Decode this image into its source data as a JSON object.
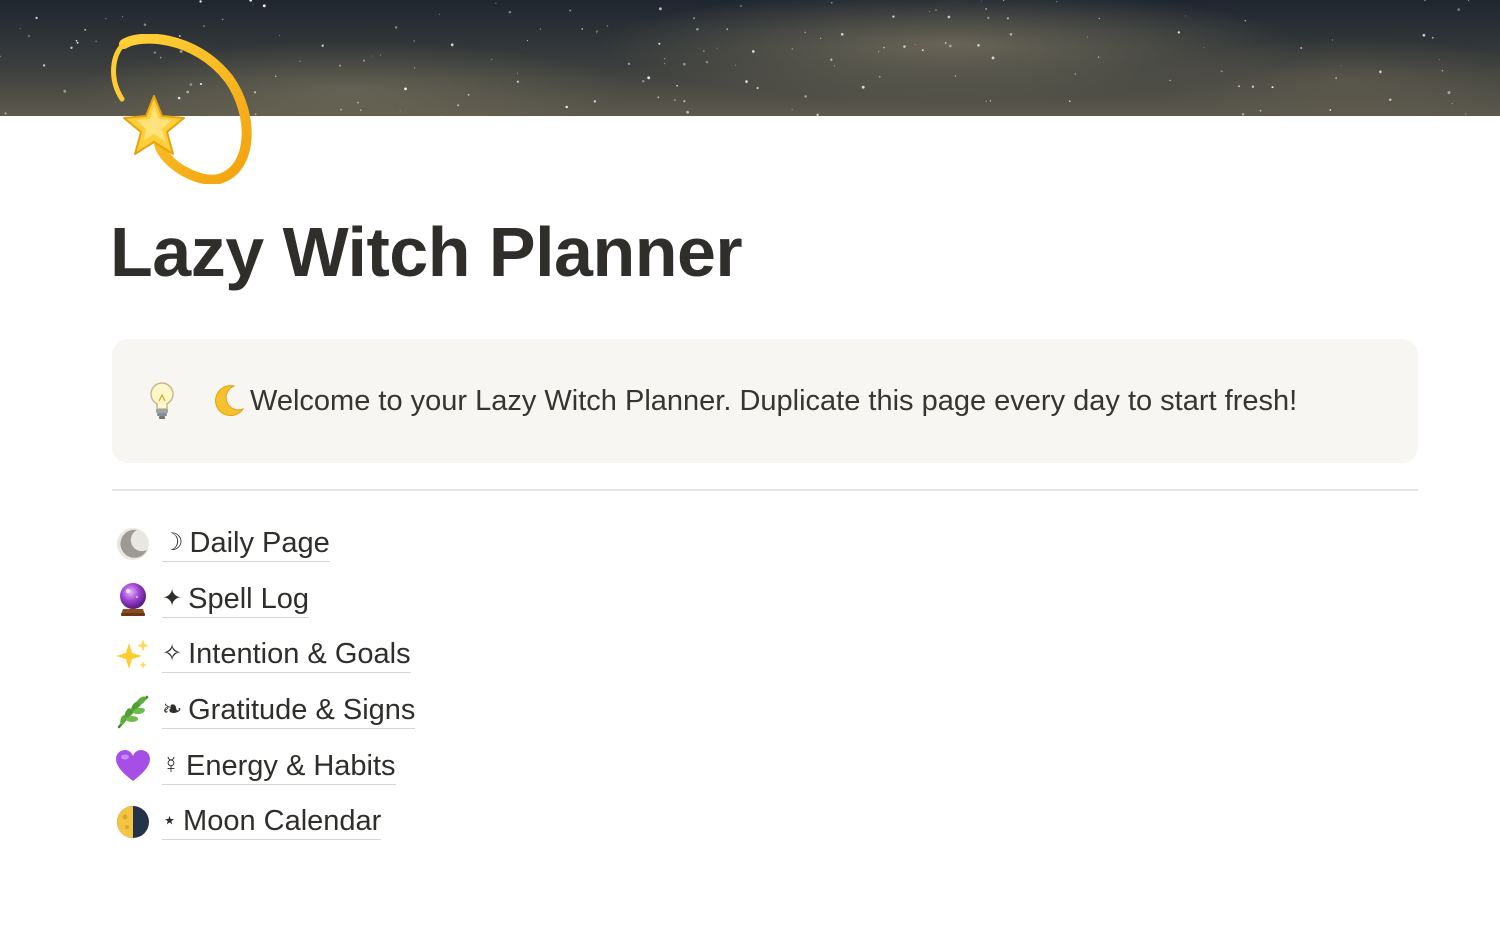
{
  "page": {
    "title": "Lazy Witch Planner",
    "icon": "dizzy-star-icon",
    "cover": "starry-night-sky"
  },
  "callout": {
    "icon": "lightbulb-icon",
    "moon_icon": "crescent-moon-icon",
    "text": "Welcome to your Lazy Witch Planner. Duplicate this page every day to start fresh!"
  },
  "links": [
    {
      "emoji": "crescent-moon-gray-icon",
      "glyph": "☽",
      "label": "Daily Page"
    },
    {
      "emoji": "crystal-ball-icon",
      "glyph": "✦",
      "label": "Spell Log"
    },
    {
      "emoji": "sparkles-icon",
      "glyph": "✧",
      "label": "Intention & Goals"
    },
    {
      "emoji": "herb-icon",
      "glyph": "❧",
      "label": "Gratitude & Signs"
    },
    {
      "emoji": "purple-heart-icon",
      "glyph": "☿",
      "label": "Energy & Habits"
    },
    {
      "emoji": "first-quarter-moon-icon",
      "glyph": "⋆",
      "label": "Moon Calendar"
    }
  ],
  "colors": {
    "text": "#37352f",
    "callout_bg": "#f7f6f3",
    "divider": "#e6e5e1"
  }
}
